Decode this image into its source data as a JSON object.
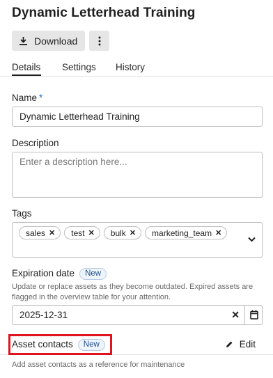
{
  "page": {
    "title": "Dynamic Letterhead Training"
  },
  "toolbar": {
    "download_label": "Download",
    "download_icon": "download-icon",
    "more_icon": "more-vertical-icon"
  },
  "tabs": [
    {
      "label": "Details",
      "active": true
    },
    {
      "label": "Settings",
      "active": false
    },
    {
      "label": "History",
      "active": false
    }
  ],
  "form": {
    "name": {
      "label": "Name",
      "required_marker": "*",
      "value": "Dynamic Letterhead Training"
    },
    "description": {
      "label": "Description",
      "placeholder": "Enter a description here..."
    },
    "tags": {
      "label": "Tags",
      "items": [
        "sales",
        "test",
        "bulk",
        "marketing_team"
      ],
      "remove_glyph": "✕",
      "expand_icon": "chevron-down-icon"
    },
    "expiration": {
      "label": "Expiration date",
      "badge": "New",
      "help": "Update or replace assets as they become outdated. Expired assets are flagged in the overview table for your attention.",
      "value": "2025-12-31",
      "clear_glyph": "✕",
      "calendar_icon": "calendar-icon"
    },
    "asset_contacts": {
      "label": "Asset contacts",
      "badge": "New",
      "edit_label": "Edit",
      "edit_icon": "pencil-icon",
      "help": "Add asset contacts as a reference for maintenance"
    }
  },
  "colors": {
    "required": "#1d6ec7",
    "badge_text": "#1f4f8b",
    "badge_bg": "#eef4fc",
    "highlight": "#e0141e"
  }
}
